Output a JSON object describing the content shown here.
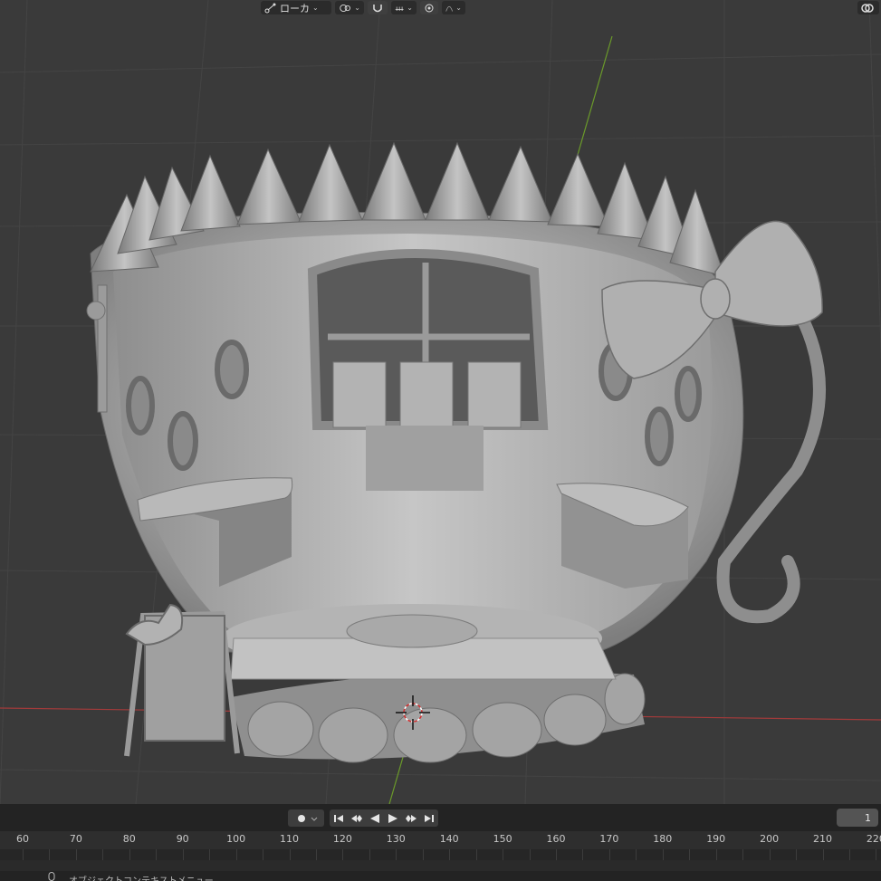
{
  "header": {
    "transform_orientation": "ローカ",
    "frame_current": "1"
  },
  "timeline": {
    "ticks": [
      "60",
      "70",
      "80",
      "90",
      "100",
      "110",
      "120",
      "130",
      "140",
      "150",
      "160",
      "170",
      "180",
      "190",
      "200",
      "210",
      "220"
    ]
  },
  "status": {
    "message": "オブジェクトコンテキストメニュー"
  },
  "colors": {
    "viewport_bg": "#3a3a3a",
    "grid_line": "#444444",
    "axis_x": "#a33a3a",
    "axis_y": "#6b9a2a",
    "model_gray": "#9a9a9a"
  }
}
